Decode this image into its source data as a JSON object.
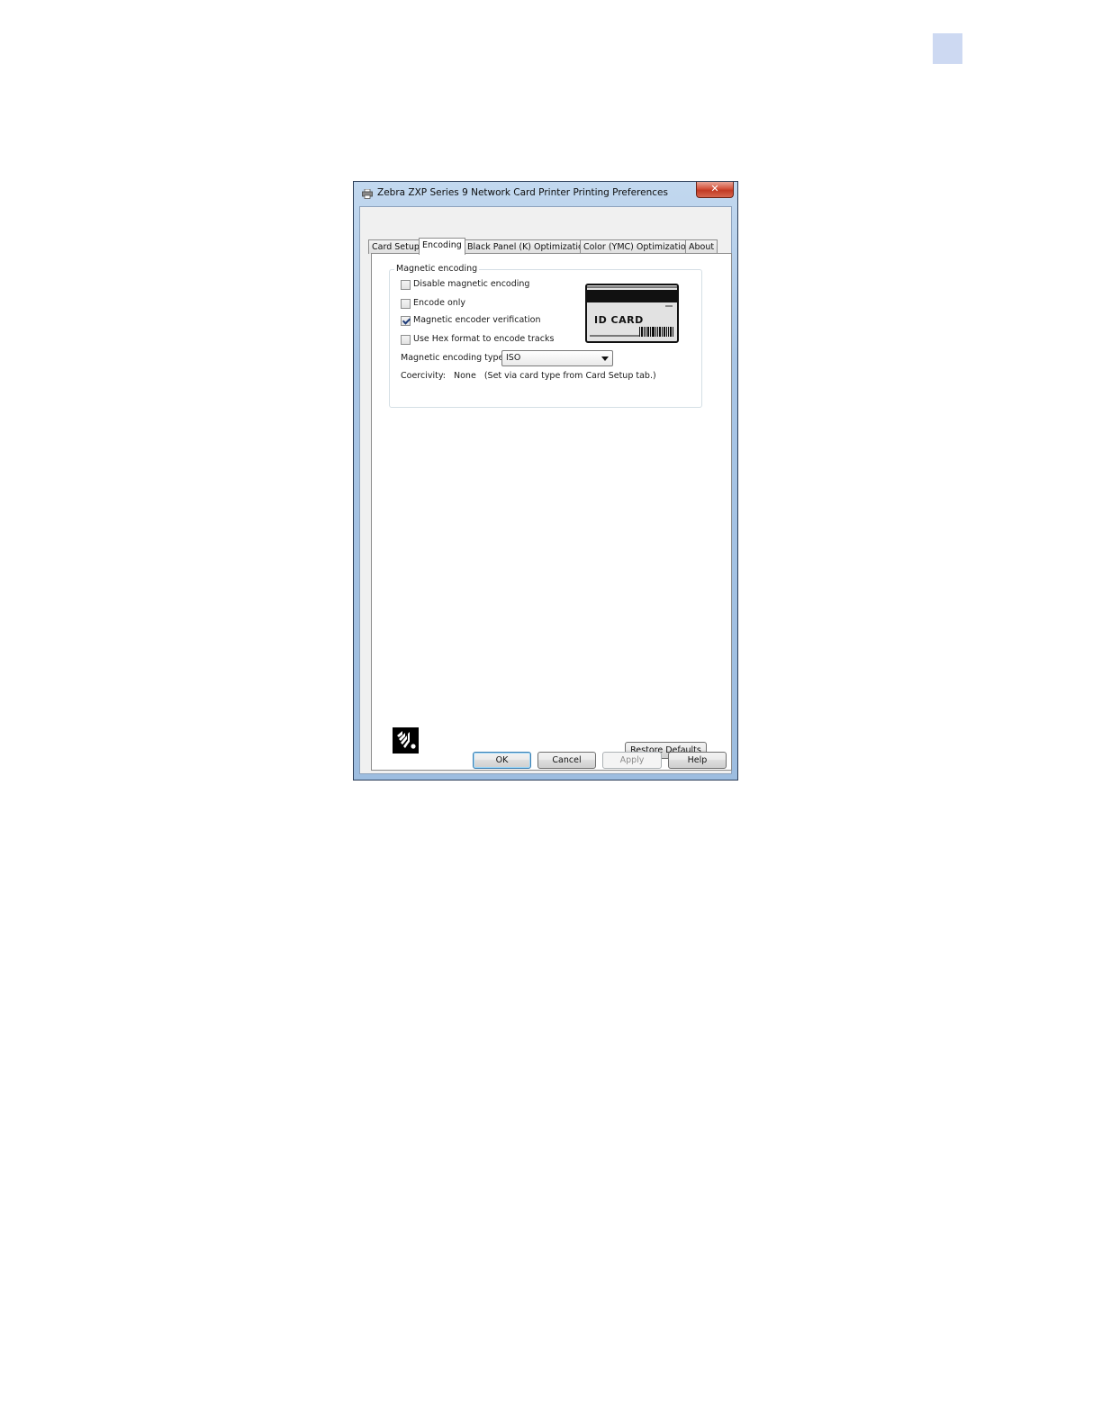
{
  "window": {
    "title": "Zebra ZXP Series 9 Network Card Printer Printing Preferences",
    "title_icon": "printer-icon",
    "close_glyph": "✕"
  },
  "tabs": [
    {
      "label": "Card Setup",
      "active": false
    },
    {
      "label": "Encoding",
      "active": true
    },
    {
      "label": "Black Panel (K) Optimization",
      "active": false
    },
    {
      "label": "Color (YMC) Optimization",
      "active": false
    },
    {
      "label": "About",
      "active": false
    }
  ],
  "magnetic": {
    "group_label": "Magnetic encoding",
    "options": [
      {
        "label": "Disable magnetic encoding",
        "checked": false
      },
      {
        "label": "Encode only",
        "checked": false
      },
      {
        "label": "Magnetic encoder verification",
        "checked": true
      },
      {
        "label": "Use Hex format to encode tracks",
        "checked": false
      }
    ],
    "type_label": "Magnetic encoding type",
    "type_value": "ISO",
    "coercivity_label": "Coercivity:",
    "coercivity_value": "None",
    "coercivity_note": "(Set via card type from Card Setup tab.)",
    "card_image_text": "ID CARD"
  },
  "footer": {
    "logo_icon": "zebra-logo-icon",
    "restore_label": "Restore Defaults"
  },
  "buttons": {
    "ok": "OK",
    "cancel": "Cancel",
    "apply": "Apply",
    "help": "Help"
  },
  "colors": {
    "page_tab": "#cdd9f2",
    "title_gradient": "#a9c6e6",
    "close_button": "#c13a23"
  }
}
